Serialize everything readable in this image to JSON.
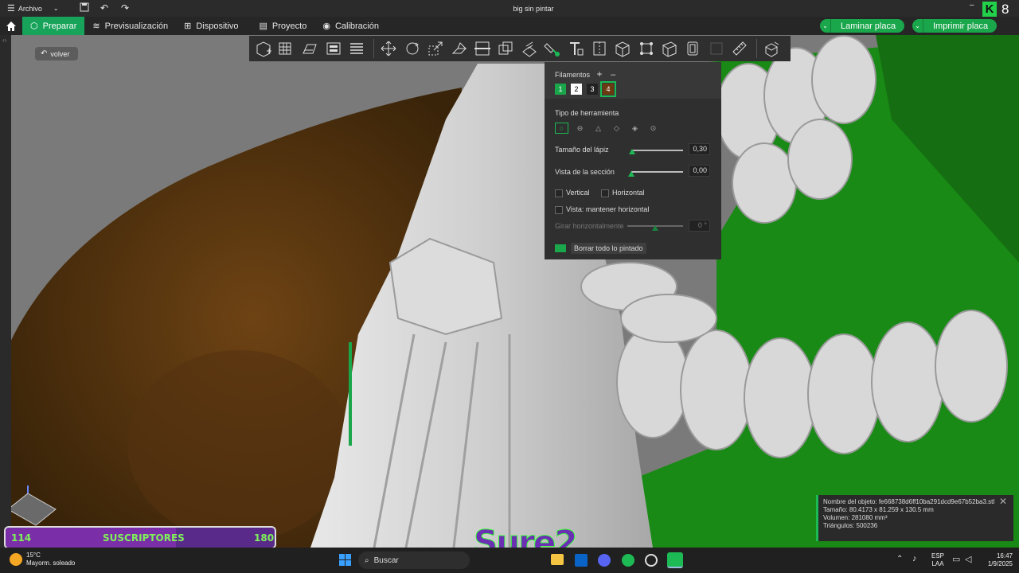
{
  "window": {
    "menu_label": "Archivo",
    "title": "big sin pintar",
    "badge_letter": "8"
  },
  "nav": {
    "tabs": [
      {
        "label": "Preparar",
        "icon": "cube-icon"
      },
      {
        "label": "Previsualización",
        "icon": "layers-icon"
      },
      {
        "label": "Dispositivo",
        "icon": "device-icon"
      },
      {
        "label": "Proyecto",
        "icon": "project-icon"
      },
      {
        "label": "Calibración",
        "icon": "calibration-icon"
      }
    ],
    "active_tab": "Preparar",
    "laminar_label": "Laminar placa",
    "imprimir_label": "Imprimir placa"
  },
  "viewport": {
    "back_label": "volver"
  },
  "paint_panel": {
    "filamentos_label": "Filamentos",
    "add_symbol": "+",
    "remove_symbol": "–",
    "filaments": [
      {
        "num": "1",
        "color": "#1aa64b"
      },
      {
        "num": "2",
        "color": "#ffffff"
      },
      {
        "num": "3",
        "color": "#222222"
      },
      {
        "num": "4",
        "color": "#6b3a11"
      }
    ],
    "selected_filament": "4",
    "tool_type_label": "Tipo de herramienta",
    "pencil_size_label": "Tamaño del lápiz",
    "pencil_size_value": "0,30",
    "pencil_size_level": 0.02,
    "section_view_label": "Vista de la sección",
    "section_view_value": "0,00",
    "section_view_level": 0.0,
    "vertical_label": "Vertical",
    "horizontal_label": "Horizontal",
    "keep_horizontal_label": "Vista: mantener horizontal",
    "rotate_label": "Girar horizontalmente",
    "rotate_value": "0 °",
    "rotate_level": 0.5,
    "clear_label": "Borrar todo lo pintado"
  },
  "object_info": {
    "name": "Nombre del objeto: fe668738d6ff10ba291dcd9e67b52ba3.stl",
    "size": "Tamaño: 80.4173 x 81.259 x 130.5 mm",
    "volume": "Volumen: 281080 mm³",
    "triangles": "Triángulos: 500236"
  },
  "overlay": {
    "subs_left": "114",
    "subs_label": "SUSCRIPTORES",
    "subs_right": "180",
    "subs_progress": 0.633,
    "watermark": "Sure2"
  },
  "taskbar": {
    "weather_temp": "15°C",
    "weather_desc": "Mayorm. soleado",
    "search_label": "Buscar",
    "lang_top": "ESP",
    "lang_bottom": "LAA",
    "time": "16:47",
    "date": "1/9/2025"
  }
}
